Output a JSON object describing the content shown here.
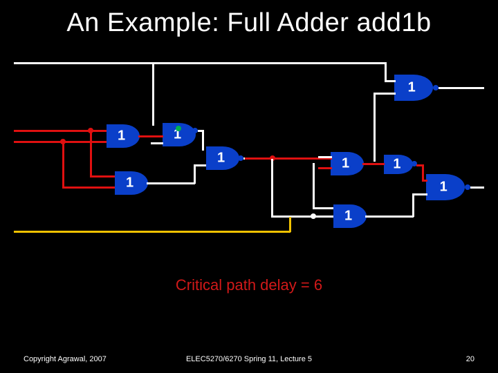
{
  "title": "An Example: Full Adder add1b",
  "caption": "Critical path delay = 6",
  "footer": {
    "left": "Copyright Agrawal, 2007",
    "center": "ELEC5270/6270 Spring 11, Lecture 5",
    "right": "20"
  },
  "gates": {
    "g1": {
      "label": "1"
    },
    "g2": {
      "label": "1"
    },
    "g3": {
      "label": "1"
    },
    "g4": {
      "label": "1"
    },
    "g5": {
      "label": "1"
    },
    "g6": {
      "label": "1"
    },
    "g7": {
      "label": "1"
    },
    "g8": {
      "label": "1"
    },
    "g9": {
      "label": "1"
    }
  },
  "chart_data": {
    "type": "table",
    "description": "Full adder gate-level schematic with nine 2-input gates (each unit delay 1). Critical path length is 6.",
    "gate_delays": [
      1,
      1,
      1,
      1,
      1,
      1,
      1,
      1,
      1
    ],
    "critical_path_delay": 6
  }
}
